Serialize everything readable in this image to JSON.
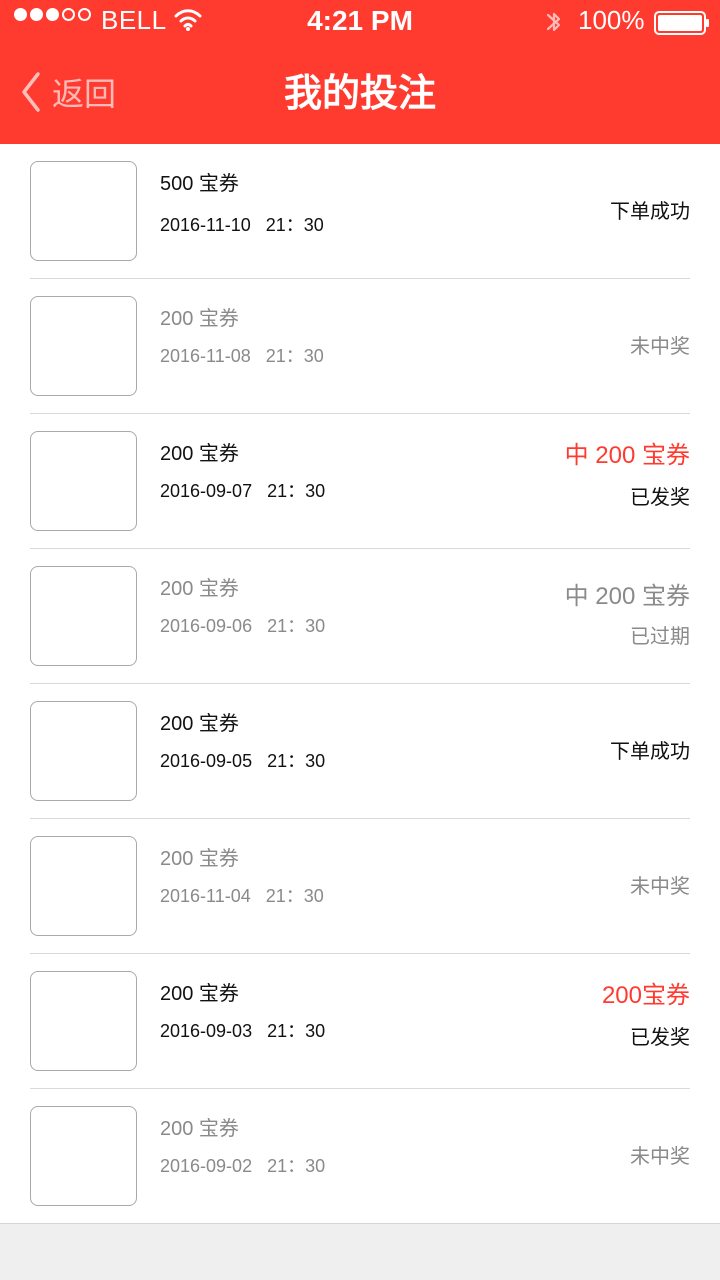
{
  "status_bar": {
    "carrier": "BELL",
    "time": "4:21 PM",
    "battery_percent": "100%",
    "signal_strength": {
      "filled": 3,
      "total": 5
    },
    "icons": [
      "wifi-icon",
      "bluetooth-icon",
      "battery-icon"
    ]
  },
  "header": {
    "back_label": "返回",
    "title": "我的投注",
    "icons": [
      "chevron-left-icon"
    ]
  },
  "theme": {
    "accent": "#ff3b30",
    "text_primary": "#111111",
    "text_muted": "#8a8a8a",
    "divider": "#d9d9d9",
    "footer_bg": "#efefef"
  },
  "bets": [
    {
      "amount": "500 宝券",
      "datetime": "2016-11-10   21：30",
      "status": "下单成功",
      "state": "active",
      "prize_color": "none"
    },
    {
      "amount": "200 宝券",
      "datetime": "2016-11-08   21：30",
      "status": "未中奖",
      "state": "muted",
      "prize_color": "none"
    },
    {
      "amount": "200 宝券",
      "datetime": "2016-09-07   21：30",
      "prize": "中 200 宝券",
      "status": "已发奖",
      "state": "active",
      "prize_color": "red"
    },
    {
      "amount": "200 宝券",
      "datetime": "2016-09-06   21：30",
      "prize": "中 200 宝券",
      "status": "已过期",
      "state": "muted",
      "prize_color": "gray"
    },
    {
      "amount": "200 宝券",
      "datetime": "2016-09-05   21：30",
      "status": "下单成功",
      "state": "active",
      "prize_color": "none"
    },
    {
      "amount": "200 宝券",
      "datetime": "2016-11-04   21：30",
      "status": "未中奖",
      "state": "muted",
      "prize_color": "none"
    },
    {
      "amount": "200 宝券",
      "datetime": "2016-09-03   21：30",
      "prize": "200宝券",
      "status": "已发奖",
      "state": "active",
      "prize_color": "red"
    },
    {
      "amount": "200 宝券",
      "datetime": "2016-09-02   21：30",
      "status": "未中奖",
      "state": "muted",
      "prize_color": "none"
    }
  ]
}
